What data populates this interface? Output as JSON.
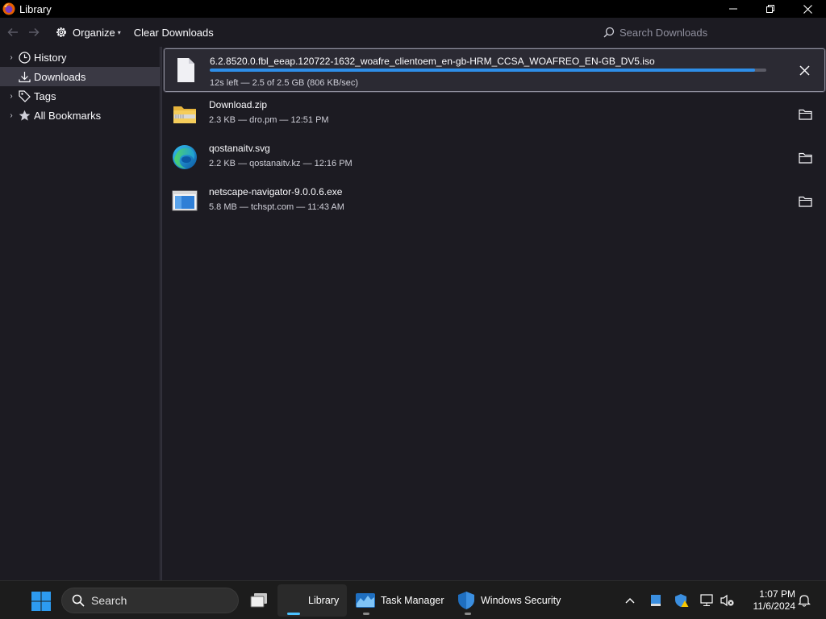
{
  "window": {
    "title": "Library"
  },
  "toolbar": {
    "organize_label": "Organize",
    "clear_label": "Clear Downloads",
    "search_placeholder": "Search Downloads"
  },
  "sidebar": {
    "items": [
      {
        "label": "History",
        "icon": "clock-icon",
        "expandable": true
      },
      {
        "label": "Downloads",
        "icon": "download-icon",
        "expandable": false,
        "selected": true
      },
      {
        "label": "Tags",
        "icon": "tag-icon",
        "expandable": true
      },
      {
        "label": "All Bookmarks",
        "icon": "star-icon",
        "expandable": true
      }
    ]
  },
  "downloads": [
    {
      "name": "6.2.8520.0.fbl_eeap.120722-1632_woafre_clientoem_en-gb-HRM_CCSA_WOAFREO_EN-GB_DV5.iso",
      "status": "12s left — 2.5 of 2.5 GB (806 KB/sec)",
      "progress": 0.98,
      "icon": "generic-file-icon",
      "in_progress": true
    },
    {
      "name": "Download.zip",
      "status": "2.3 KB — dro.pm — 12:51 PM",
      "icon": "zip-folder-icon"
    },
    {
      "name": "qostanaitv.svg",
      "status": "2.2 KB — qostanaitv.kz — 12:16 PM",
      "icon": "edge-icon"
    },
    {
      "name": "netscape-navigator-9.0.0.6.exe",
      "status": "5.8 MB — tchspt.com — 11:43 AM",
      "icon": "exe-window-icon"
    }
  ],
  "taskbar": {
    "search_label": "Search",
    "apps": [
      {
        "label": "Library",
        "active": true
      },
      {
        "label": "Task Manager",
        "active": false
      },
      {
        "label": "Windows Security",
        "active": false
      }
    ],
    "clock_time": "1:07 PM",
    "clock_date": "11/6/2024"
  },
  "colors": {
    "accent": "#2e8ee8",
    "taskbar_accent": "#4cc2ff",
    "background": "#1c1b22",
    "selected": "#3a3944"
  }
}
